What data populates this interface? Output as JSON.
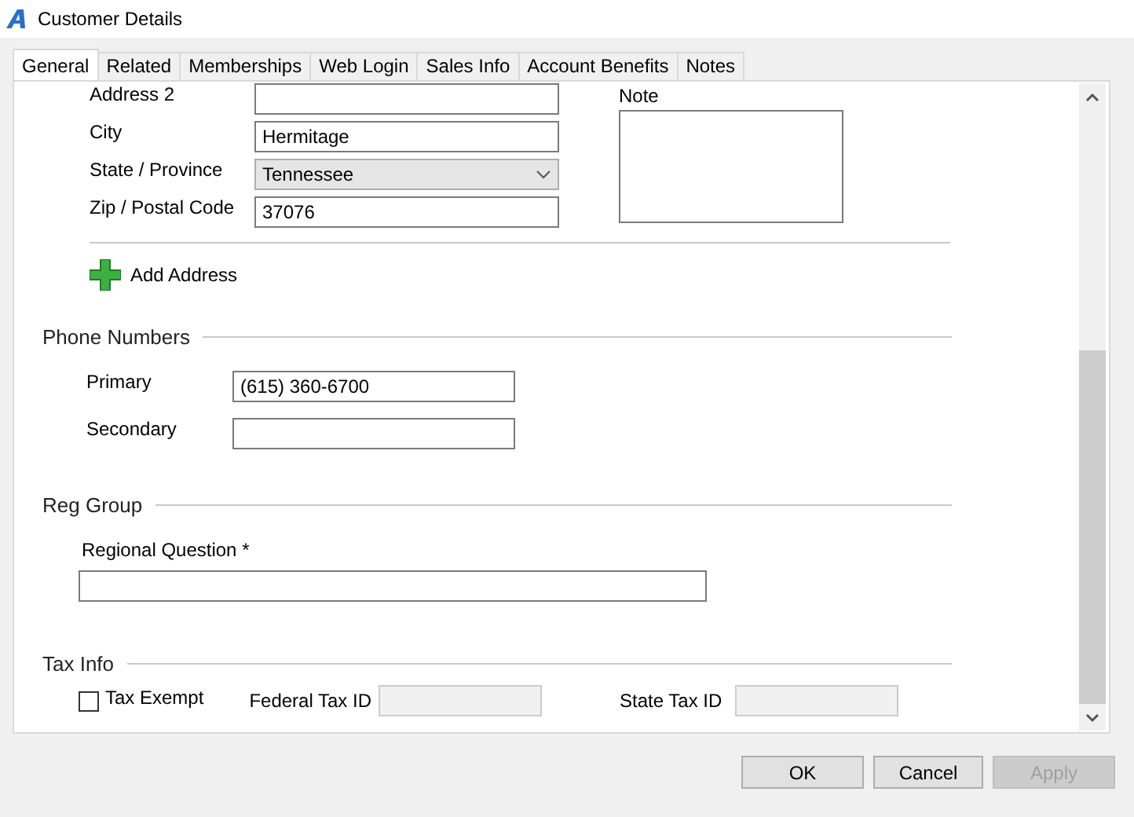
{
  "window": {
    "title": "Customer Details"
  },
  "tabs": [
    {
      "label": "General",
      "selected": true
    },
    {
      "label": "Related",
      "selected": false
    },
    {
      "label": "Memberships",
      "selected": false
    },
    {
      "label": "Web Login",
      "selected": false
    },
    {
      "label": "Sales Info",
      "selected": false
    },
    {
      "label": "Account Benefits",
      "selected": false
    },
    {
      "label": "Notes",
      "selected": false
    }
  ],
  "address": {
    "fields": [
      {
        "label": "Address 2",
        "kind": "text"
      },
      {
        "label": "City",
        "kind": "text",
        "value": "Hermitage"
      },
      {
        "label": "State / Province",
        "kind": "dropdown",
        "value": "Tennessee"
      },
      {
        "label": "Zip / Postal Code",
        "kind": "text",
        "value": "37076"
      }
    ],
    "note_label": "Note",
    "add_button": "Add Address"
  },
  "phone_numbers": {
    "heading": "Phone Numbers",
    "fields": [
      {
        "label": "Primary",
        "value": "(615) 360-6700"
      },
      {
        "label": "Secondary"
      }
    ]
  },
  "reg_group": {
    "heading": "Reg Group",
    "question_label": "Regional Question *"
  },
  "tax_info": {
    "heading": "Tax Info",
    "tax_exempt": {
      "label": "Tax Exempt",
      "checked": false
    },
    "federal_tax_id": {
      "label": "Federal Tax ID",
      "disabled": true
    },
    "state_tax_id": {
      "label": "State Tax ID",
      "disabled": true
    }
  },
  "buttons": [
    {
      "label": "OK",
      "disabled": false
    },
    {
      "label": "Cancel",
      "disabled": false
    },
    {
      "label": "Apply",
      "disabled": true
    }
  ]
}
